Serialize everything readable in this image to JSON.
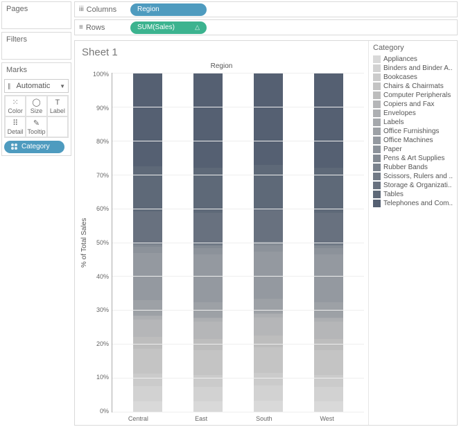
{
  "panels": {
    "pages": "Pages",
    "filters": "Filters",
    "marks": "Marks",
    "marks_type": "Automatic",
    "marks_cells": [
      "Color",
      "Size",
      "Label",
      "Detail",
      "Tooltip"
    ],
    "category_pill": "Category"
  },
  "shelves": {
    "columns_label": "Columns",
    "rows_label": "Rows",
    "columns_pill": "Region",
    "rows_pill": "SUM(Sales)"
  },
  "viz": {
    "sheet_title": "Sheet 1",
    "col_axis_title": "Region",
    "y_axis_title": "% of Total Sales",
    "y_ticks": [
      "100%",
      "90%",
      "80%",
      "70%",
      "60%",
      "50%",
      "40%",
      "30%",
      "20%",
      "10%",
      "0%"
    ],
    "x_ticks": [
      "Central",
      "East",
      "South",
      "West"
    ]
  },
  "legend": {
    "title": "Category",
    "items": [
      "Appliances",
      "Binders and Binder A..",
      "Bookcases",
      "Chairs & Chairmats",
      "Computer Peripherals",
      "Copiers and Fax",
      "Envelopes",
      "Labels",
      "Office Furnishings",
      "Office Machines",
      "Paper",
      "Pens & Art Supplies",
      "Rubber Bands",
      "Scissors, Rulers and ..",
      "Storage & Organizati..",
      "Tables",
      "Telephones and Com.."
    ]
  },
  "chart_data": {
    "type": "bar",
    "stacked": true,
    "normalized": true,
    "ylabel": "% of Total Sales",
    "xlabel": "Region",
    "ylim": [
      0,
      100
    ],
    "categories": [
      "Central",
      "East",
      "South",
      "West"
    ],
    "series_palette": [
      "#d9d9d9",
      "#d2d2d2",
      "#cbcbcb",
      "#c4c4c4",
      "#bdbdbd",
      "#b5b6b8",
      "#adafb2",
      "#a5a8ac",
      "#9da1a6",
      "#9499a0",
      "#8c929a",
      "#838a93",
      "#7a828d",
      "#717a86",
      "#68717f",
      "#5e6978",
      "#556072"
    ],
    "series": [
      {
        "name": "Appliances",
        "values": [
          3.1,
          3.0,
          3.2,
          3.0
        ]
      },
      {
        "name": "Binders and Binder Accessories",
        "values": [
          4.5,
          4.4,
          4.6,
          4.4
        ]
      },
      {
        "name": "Bookcases",
        "values": [
          3.6,
          3.5,
          3.7,
          3.5
        ]
      },
      {
        "name": "Chairs & Chairmats",
        "values": [
          7.4,
          7.3,
          7.5,
          7.3
        ]
      },
      {
        "name": "Computer Peripherals",
        "values": [
          3.4,
          3.3,
          3.5,
          3.3
        ]
      },
      {
        "name": "Copiers and Fax",
        "values": [
          5.2,
          5.1,
          5.3,
          5.1
        ]
      },
      {
        "name": "Envelopes",
        "values": [
          1.0,
          1.0,
          1.0,
          1.0
        ]
      },
      {
        "name": "Labels",
        "values": [
          0.3,
          0.3,
          0.3,
          0.3
        ]
      },
      {
        "name": "Office Furnishings",
        "values": [
          4.4,
          4.5,
          4.3,
          4.5
        ]
      },
      {
        "name": "Office Machines",
        "values": [
          14.0,
          14.1,
          13.9,
          14.1
        ]
      },
      {
        "name": "Paper",
        "values": [
          1.8,
          1.8,
          1.8,
          1.8
        ]
      },
      {
        "name": "Pens & Art Supplies",
        "values": [
          0.7,
          0.7,
          0.7,
          0.7
        ]
      },
      {
        "name": "Rubber Bands",
        "values": [
          0.1,
          0.1,
          0.1,
          0.1
        ]
      },
      {
        "name": "Scissors, Rulers and Trimmers",
        "values": [
          0.4,
          0.4,
          0.4,
          0.4
        ]
      },
      {
        "name": "Storage & Organization",
        "values": [
          9.3,
          9.3,
          9.3,
          9.3
        ]
      },
      {
        "name": "Tables",
        "values": [
          13.2,
          13.2,
          13.2,
          13.2
        ]
      },
      {
        "name": "Telephones and Communication",
        "values": [
          27.6,
          28.0,
          27.2,
          28.0
        ]
      }
    ]
  }
}
